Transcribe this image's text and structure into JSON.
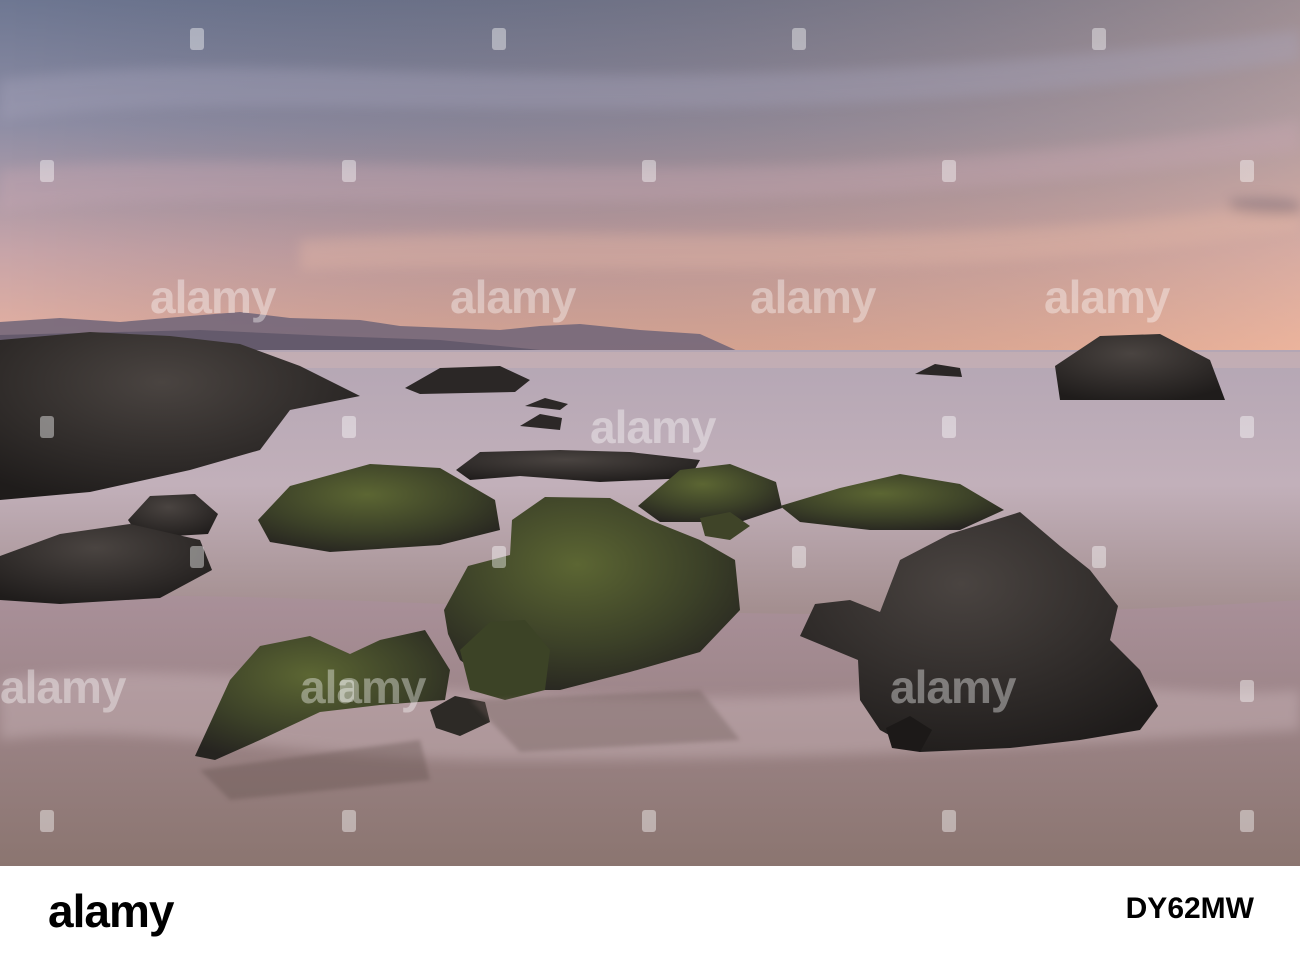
{
  "photo": {
    "scene": "coastal-rocks-sunset-long-exposure",
    "colors": {
      "sky_top": "#6f7893",
      "sky_mid": "#b7a2ab",
      "horizon_glow": "#f0b49a",
      "sea": "#b8a7b2",
      "sand": "#9a8480",
      "rock": "#2e2a28",
      "moss": "#4f5a2c"
    }
  },
  "watermark": {
    "text": "alamy"
  },
  "footer": {
    "logo": "alamy",
    "image_code": "DY62MW"
  }
}
